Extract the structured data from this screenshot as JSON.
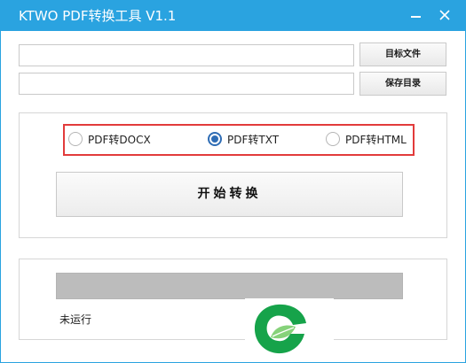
{
  "window": {
    "title": "KTWO PDF转换工具 V1.1",
    "minimize_glyph": "—",
    "accent_color": "#2aa3e0"
  },
  "inputs": {
    "target_file_value": "",
    "save_dir_value": ""
  },
  "buttons": {
    "target_file": "目标文件",
    "save_dir": "保存目录",
    "start": "开始转换"
  },
  "conversion_options": [
    {
      "label": "PDF转DOCX",
      "selected": false
    },
    {
      "label": "PDF转TXT",
      "selected": true
    },
    {
      "label": "PDF转HTML",
      "selected": false
    }
  ],
  "highlight_color": "#e23b3b",
  "progress": {
    "fraction": 0.0,
    "track_color": "#bcbcbc"
  },
  "status": {
    "text": "未运行"
  },
  "icons": {
    "minimize": "minimize-icon",
    "close": "close-icon",
    "watermark": "leaf-logo-icon"
  }
}
